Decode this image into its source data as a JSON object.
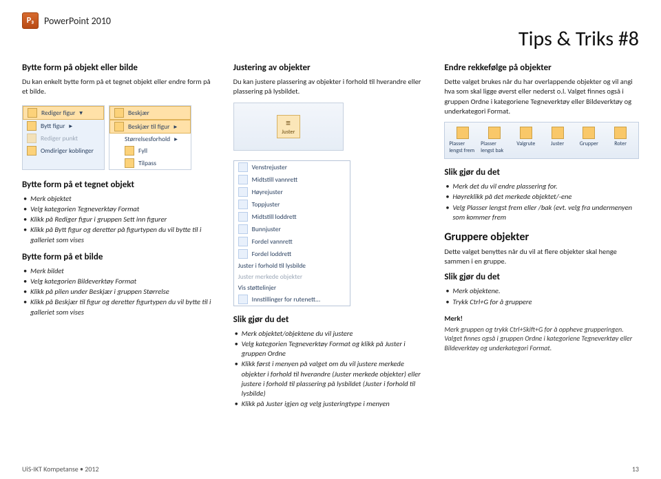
{
  "header": {
    "appName": "PowerPoint 2010"
  },
  "pageTitle": "Tips & Triks #8",
  "col1": {
    "h1": "Bytte form på objekt eller bilde",
    "p1": "Du kan enkelt bytte form på et tegnet objekt eller endre form på et bilde.",
    "editMenu": {
      "btn": "Rediger figur",
      "i1": "Bytt figur",
      "i2": "Rediger punkt",
      "i3": "Omdiriger koblinger"
    },
    "shapeSubmenu": {
      "s1": "Beskjær",
      "s2": "Beskjær til figur",
      "s3": "Størrelsesforhold",
      "s4": "Fyll",
      "s5": "Tilpass"
    },
    "h2": "Bytte form på et tegnet objekt",
    "list2": [
      "Merk objektet",
      "Velg kategorien Tegneverktøy Format",
      "Klikk på Rediger figur i gruppen Sett inn figurer",
      "Klikk på Bytt figur og deretter på figurtypen du vil bytte til i galleriet som vises"
    ],
    "h3": "Bytte form på et bilde",
    "list3": [
      "Merk bildet",
      "Velg kategorien Bildeverktøy Format",
      "Klikk på pilen under Beskjær i gruppen Størrelse",
      "Klikk på Beskjær til figur og deretter figurtypen du vil bytte til i galleriet som vises"
    ]
  },
  "col2": {
    "h1": "Justering av objekter",
    "p1": "Du kan justere plassering av objekter i forhold til hverandre eller plassering på lysbildet.",
    "alignBtn": "Juster",
    "alignMenu": [
      "Venstrejuster",
      "Midtstill vannrett",
      "Høyrejuster",
      "Toppjuster",
      "Midtstill loddrett",
      "Bunnjuster",
      "Fordel vannrett",
      "Fordel loddrett",
      "Juster i forhold til lysbilde",
      "Juster merkede objekter",
      "Vis støttelinjer",
      "Innstillinger for rutenett..."
    ],
    "h2": "Slik gjør du det",
    "list2": [
      "Merk objektet/objektene du vil justere",
      "Velg kategorien Tegneverktøy Format og klikk på Juster i gruppen Ordne",
      "Klikk først i menyen på valget om du vil justere merkede objekter i forhold til hverandre (Juster merkede objekter) eller justere i forhold til plassering på lysbildet (Juster i forhold til lysbilde)",
      "Klikk på Juster igjen og velg justeringtype i menyen"
    ]
  },
  "col3": {
    "h1": "Endre rekkefølge på objekter",
    "p1": "Dette valget brukes når du har overlappende objekter og vil angi hva som skal ligge øverst eller nederst o.l. Valget finnes også i gruppen Ordne i kategoriene Tegneverktøy eller Bildeverktøy og underkategori Format.",
    "ribbon": [
      "Plasser lengst frem",
      "Plasser lengst bak",
      "Valgrute",
      "Juster",
      "Grupper",
      "Roter"
    ],
    "h2": "Slik gjør du det",
    "list2": [
      "Merk det du vil endre plassering for.",
      "Høyreklikk på det merkede objektet/-ene",
      "Velg Plasser lengst frem eller /bak (evt. velg fra undermenyen som kommer frem"
    ],
    "h3": "Gruppere objekter",
    "p3": "Dette valget benyttes når du vil at flere objekter skal henge sammen i en gruppe.",
    "h4": "Slik gjør du det",
    "list4": [
      "Merk objektene.",
      "Trykk Ctrl+G for å gruppere"
    ],
    "merkH": "Merk!",
    "merkP": "Merk gruppen og trykk Ctrl+Skift+G for å oppheve grupperingen. Valget finnes også i gruppen Ordne i kategoriene Tegneverktøy eller Bildeverktøy og underkategori Format."
  },
  "footer": {
    "left": "UiS-IKT Kompetanse • 2012",
    "right": "13"
  }
}
